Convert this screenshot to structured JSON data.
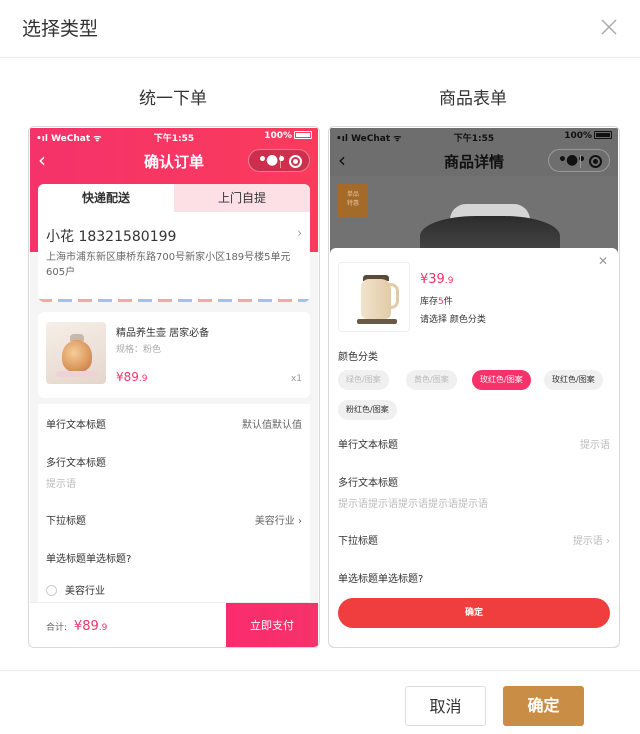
{
  "dialog": {
    "title": "选择类型",
    "cancel_label": "取消",
    "confirm_label": "确定"
  },
  "options": [
    {
      "title": "统一下单",
      "phone": {
        "statusbar": {
          "carrier": "WeChat",
          "time": "下午1:55",
          "battery": "100%"
        },
        "nav_title": "确认订单",
        "tabs": [
          "快递配送",
          "上门自提"
        ],
        "address": {
          "name": "小花  18321580199",
          "detail": "上海市浦东新区康桥东路700号新家小区189号楼5单元605户"
        },
        "product": {
          "name": "精品养生壶 居家必备",
          "spec": "规格：粉色",
          "price_symbol": "¥",
          "price_int": "89",
          "price_dec": ".9",
          "qty": "x1"
        },
        "form": [
          {
            "label": "单行文本标题",
            "value": "默认值默认值"
          },
          {
            "label": "多行文本标题",
            "hint": "提示语"
          },
          {
            "label": "下拉标题",
            "value": "美容行业 ›"
          },
          {
            "label": "单选标题单选标题?"
          },
          {
            "radio": "美容行业"
          }
        ],
        "pay": {
          "total_label": "合计:",
          "amount_symbol": "¥",
          "amount_int": "89",
          "amount_dec": ".9",
          "button": "立即支付"
        }
      }
    },
    {
      "title": "商品表单",
      "phone": {
        "statusbar": {
          "carrier": "WeChat",
          "time": "下午1:55",
          "battery": "100%"
        },
        "nav_title": "商品详情",
        "ribbon": "单品\n特惠",
        "sku": {
          "price_symbol": "¥",
          "price_int": "39",
          "price_dec": ".9",
          "stock_prefix": "库存",
          "stock_num": "5",
          "stock_suffix": "件",
          "select_text": "请选择 颜色分类"
        },
        "color_label": "颜色分类",
        "chips": [
          "绿色/图案",
          "黄色/图案",
          "玫红色/图案",
          "玫红色/图案",
          "粉红色/图案"
        ],
        "form": [
          {
            "label": "单行文本标题",
            "hint": "提示语"
          },
          {
            "label": "多行文本标题",
            "hint": "提示语提示语提示语提示语提示语"
          },
          {
            "label": "下拉标题",
            "hint": "提示语 ›"
          },
          {
            "label": "单选标题单选标题?"
          }
        ],
        "confirm": "确定"
      }
    }
  ],
  "colors": {
    "brand_red": "#f5326a",
    "gold": "#c98d45"
  }
}
